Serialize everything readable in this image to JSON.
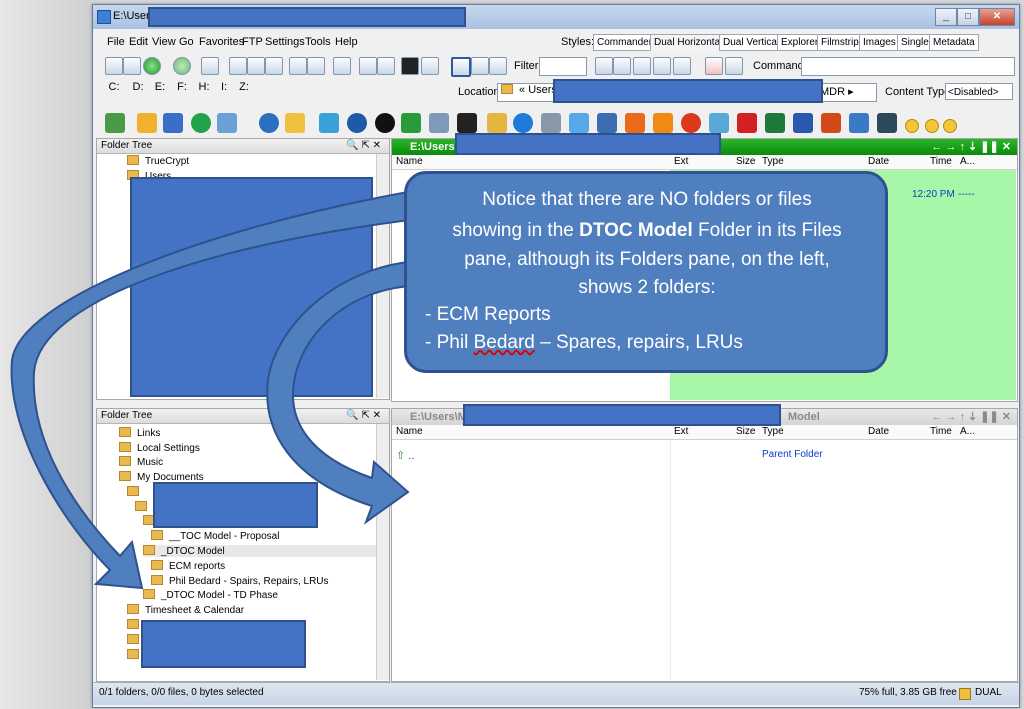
{
  "window": {
    "title": "E:\\Users\\M",
    "controls": [
      "_",
      "□",
      "✕"
    ]
  },
  "menu": [
    "File",
    "Edit",
    "View",
    "Go",
    "Favorites",
    "FTP",
    "Settings",
    "Tools",
    "Help"
  ],
  "styles": {
    "label": "Styles:",
    "tabs": [
      "Commander",
      "Dual Horizontal",
      "Dual Vertical",
      "Explorer",
      "Filmstrip",
      "Images",
      "Single",
      "Metadata"
    ],
    "active": "Dual Horizontal"
  },
  "toolbar": {
    "filter_label": "Filter",
    "command_label": "Command"
  },
  "drives": [
    "C:",
    "D:",
    "E:",
    "F:",
    "H:",
    "I:",
    "Z:"
  ],
  "location": {
    "label": "Location",
    "path_prefix": "«",
    "path_first": "Users",
    "path_end": "MDR ▸",
    "content_type_label": "Content Type",
    "content_type_value": "<Disabled>"
  },
  "top_pane": {
    "tree_header": "Folder Tree",
    "tree_items": [
      "TrueCrypt",
      "Users"
    ],
    "file_header": "E:\\Users\\",
    "columns": {
      "name": "Name",
      "ext": "Ext",
      "size": "Size",
      "type": "Type",
      "date": "Date",
      "time": "Time",
      "attr": "A..."
    },
    "first_row_time": "12:20 PM",
    "first_row_attr": "-----"
  },
  "bottom_pane": {
    "tree_header": "Folder Tree",
    "tree_items": [
      "Links",
      "Local Settings",
      "Music",
      "My Documents",
      "__TOC Model - Proposal",
      "_DTOC Model",
      "ECM reports",
      "Phil Bedard - Spairs, Repairs, LRUs",
      "_DTOC Model - TD Phase",
      "Timesheet & Calendar"
    ],
    "file_header_left": "E:\\Users\\M",
    "file_header_right": "Model",
    "columns": {
      "name": "Name",
      "ext": "Ext",
      "size": "Size",
      "type": "Type",
      "date": "Date",
      "time": "Time",
      "attr": "A..."
    },
    "rows": [
      {
        "name": "..",
        "type": "Parent Folder"
      }
    ]
  },
  "status": {
    "left": "0/1 folders, 0/0 files, 0 bytes selected",
    "right": "75% full, 3.85 GB free",
    "mode": "DUAL"
  },
  "callout": {
    "line1": "Notice that there are NO folders or files",
    "line2_pre": "showing in the ",
    "line2_bold": "DTOC Model",
    "line2_post": " Folder in its Files",
    "line3": "pane, although its Folders pane, on the left,",
    "line4": "shows 2 folders:",
    "bullet1": "- ECM Reports",
    "bullet2_pre": "- Phil ",
    "bullet2_sq": "Bedard",
    "bullet2_post": " – Spares, repairs, LRUs"
  },
  "colors": {
    "accent": "#4472c4",
    "callout_fill": "#4f7fbf",
    "active_pane_header": "#0b8b0b",
    "active_pane_bg": "#a8f7a8"
  }
}
